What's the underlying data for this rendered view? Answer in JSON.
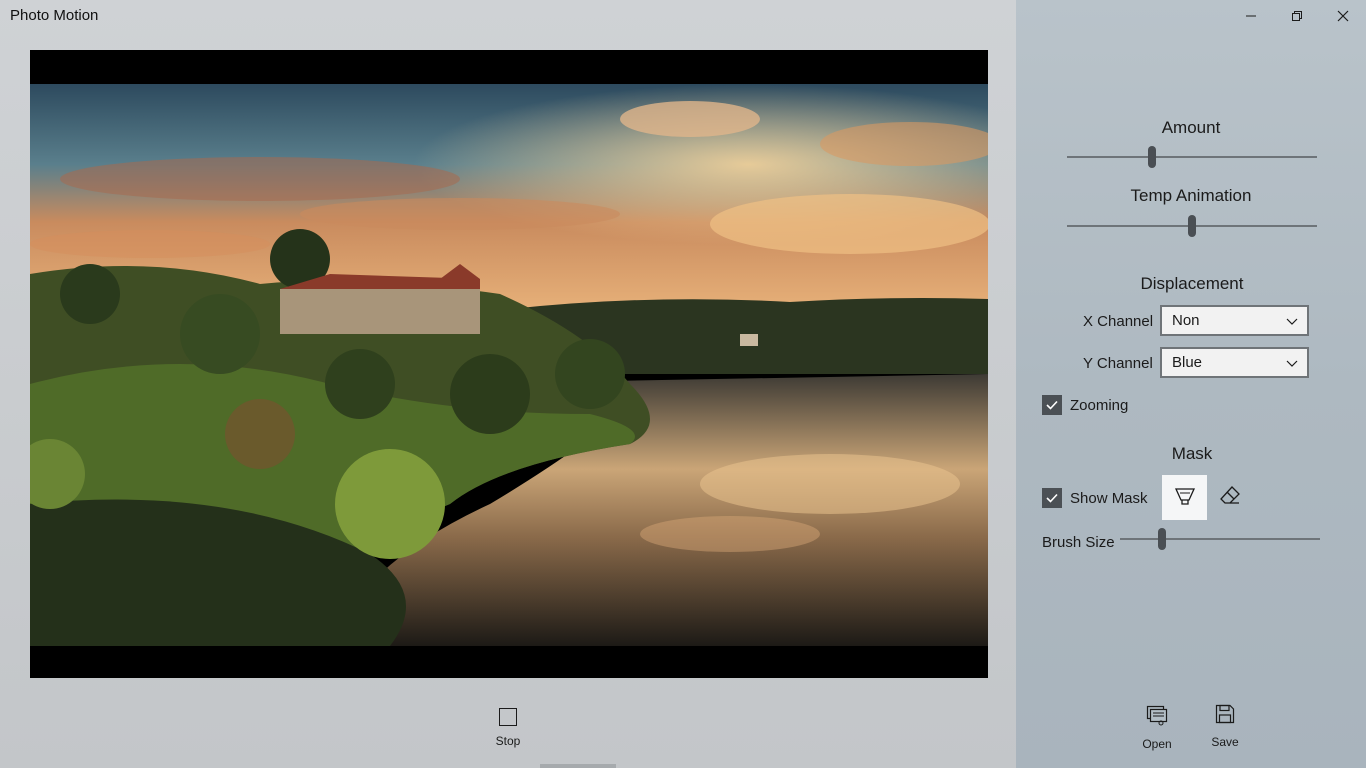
{
  "app": {
    "title": "Photo Motion"
  },
  "window_controls": {
    "minimize_icon": "minimize-icon",
    "restore_icon": "restore-icon",
    "close_icon": "close-icon"
  },
  "playback": {
    "stop_label": "Stop"
  },
  "panel": {
    "amount": {
      "label": "Amount",
      "value_fraction": 0.34
    },
    "temp_animation": {
      "label": "Temp Animation",
      "value_fraction": 0.5
    },
    "displacement": {
      "title": "Displacement",
      "x_channel_label": "X Channel",
      "x_channel_value": "Non",
      "y_channel_label": "Y Channel",
      "y_channel_value": "Blue"
    },
    "zooming": {
      "label": "Zooming",
      "checked": true
    },
    "mask": {
      "title": "Mask",
      "show_mask_label": "Show Mask",
      "show_mask_checked": true,
      "brush_icon": "brush-icon",
      "eraser_icon": "eraser-icon",
      "brush_size_label": "Brush Size",
      "brush_size_fraction": 0.21
    }
  },
  "actions": {
    "open_label": "Open",
    "save_label": "Save"
  },
  "colors": {
    "panel_bg": "#b3bec6",
    "thumb": "#4a4f54",
    "active_tool_bg": "#f5f6f7"
  }
}
